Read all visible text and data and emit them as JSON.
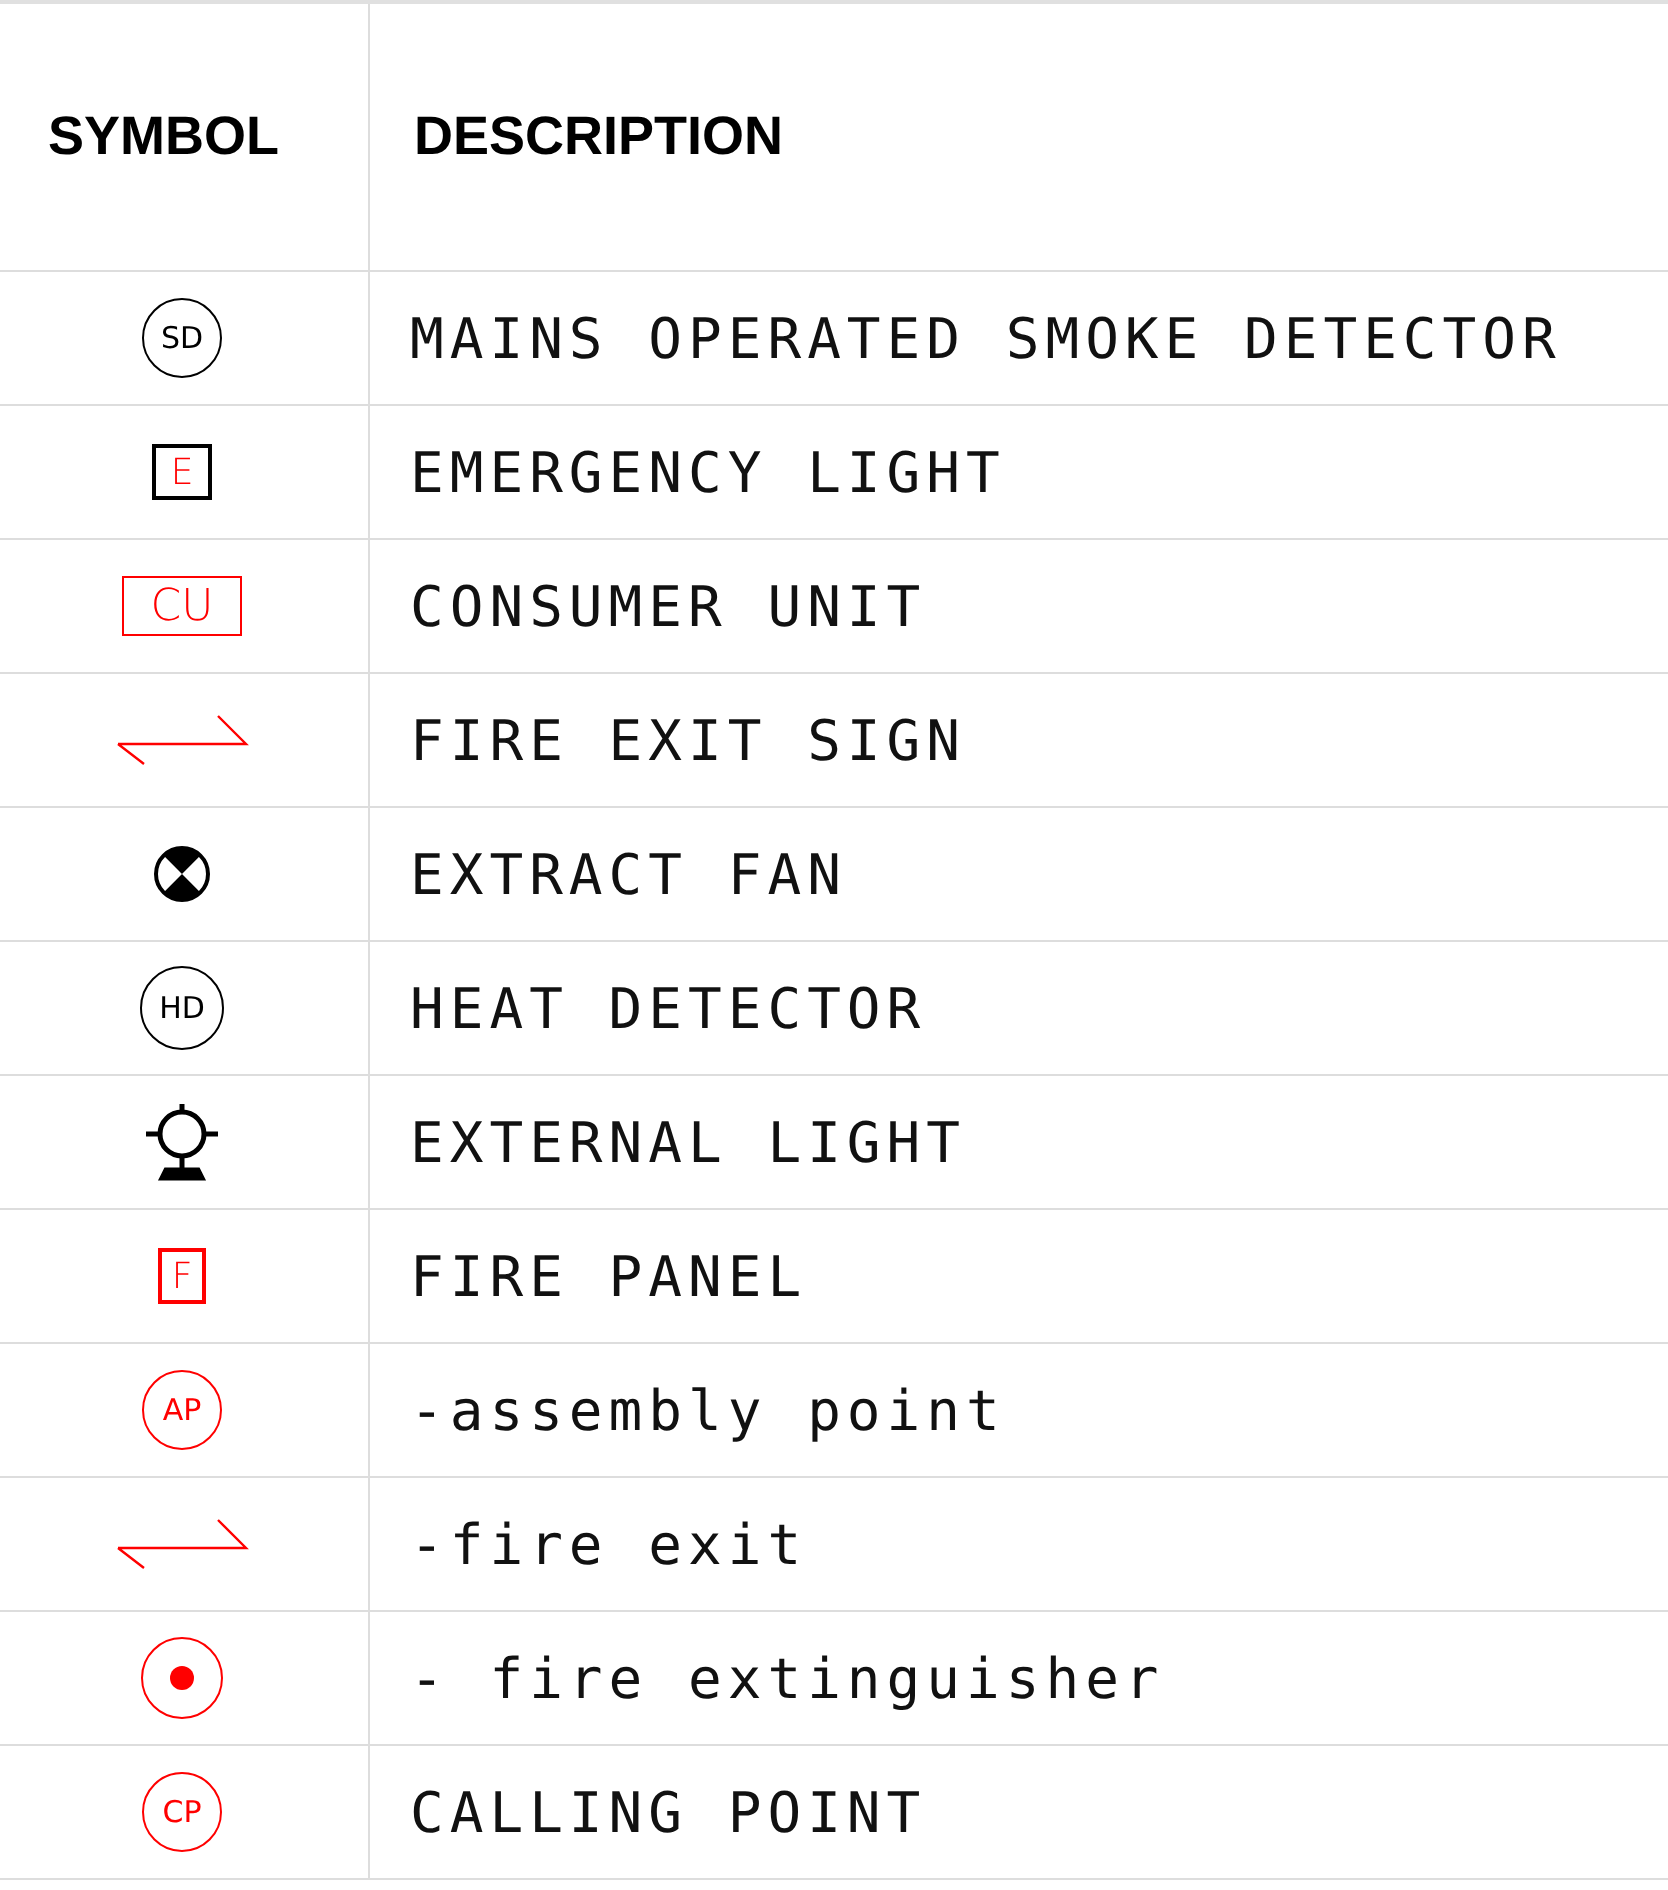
{
  "table": {
    "columns": [
      "SYMBOL",
      "DESCRIPTION"
    ],
    "rows": [
      {
        "symbol": {
          "kind": "sd",
          "label": "SD"
        },
        "description": "MAINS OPERATED SMOKE DETECTOR"
      },
      {
        "symbol": {
          "kind": "e-box",
          "label": "E"
        },
        "description": "EMERGENCY LIGHT"
      },
      {
        "symbol": {
          "kind": "cu-box",
          "label": "CU"
        },
        "description": "CONSUMER UNIT"
      },
      {
        "symbol": {
          "kind": "exit-arrow"
        },
        "description": "FIRE EXIT SIGN"
      },
      {
        "symbol": {
          "kind": "fan"
        },
        "description": "EXTRACT FAN"
      },
      {
        "symbol": {
          "kind": "hd",
          "label": "HD"
        },
        "description": "HEAT DETECTOR"
      },
      {
        "symbol": {
          "kind": "lamp"
        },
        "description": "EXTERNAL LIGHT"
      },
      {
        "symbol": {
          "kind": "f-box",
          "label": "F"
        },
        "description": "FIRE PANEL"
      },
      {
        "symbol": {
          "kind": "red-circle",
          "label": "AP"
        },
        "description": "-assembly point"
      },
      {
        "symbol": {
          "kind": "exit-arrow"
        },
        "description": "-fire exit"
      },
      {
        "symbol": {
          "kind": "extinguisher"
        },
        "description": "- fire extinguisher"
      },
      {
        "symbol": {
          "kind": "red-circle",
          "label": "CP"
        },
        "description": "CALLING POINT"
      }
    ]
  }
}
